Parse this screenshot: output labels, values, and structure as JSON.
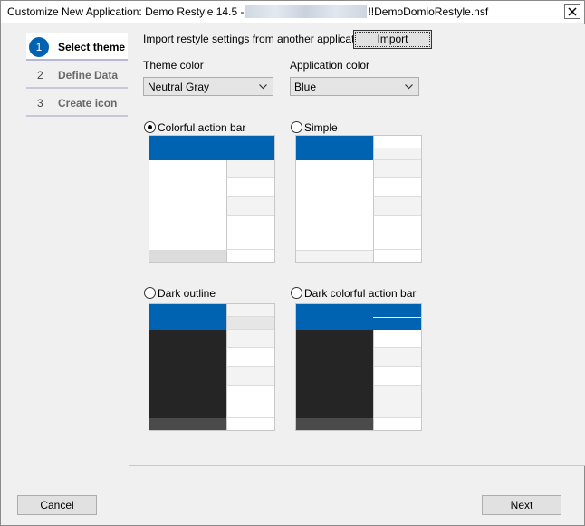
{
  "window": {
    "title_prefix": "Customize New Application: Demo Restyle 14.5 -",
    "title_suffix": "!!DemoDomioRestyle.nsf"
  },
  "steps": [
    {
      "number": "1",
      "label": "Select theme",
      "active": true
    },
    {
      "number": "2",
      "label": "Define Data",
      "active": false
    },
    {
      "number": "3",
      "label": "Create icon",
      "active": false
    }
  ],
  "import": {
    "label": "Import restyle settings from another application",
    "button": "Import"
  },
  "theme_color": {
    "label": "Theme color",
    "value": "Neutral Gray"
  },
  "application_color": {
    "label": "Application color",
    "value": "Blue"
  },
  "layouts": [
    {
      "label": "Colorful action bar",
      "selected": true
    },
    {
      "label": "Simple",
      "selected": false
    },
    {
      "label": "Dark outline",
      "selected": false
    },
    {
      "label": "Dark colorful action bar",
      "selected": false
    }
  ],
  "footer": {
    "cancel": "Cancel",
    "next": "Next"
  },
  "colors": {
    "accent": "#0063b1",
    "dark": "#252525",
    "light": "#f3f3f3"
  }
}
